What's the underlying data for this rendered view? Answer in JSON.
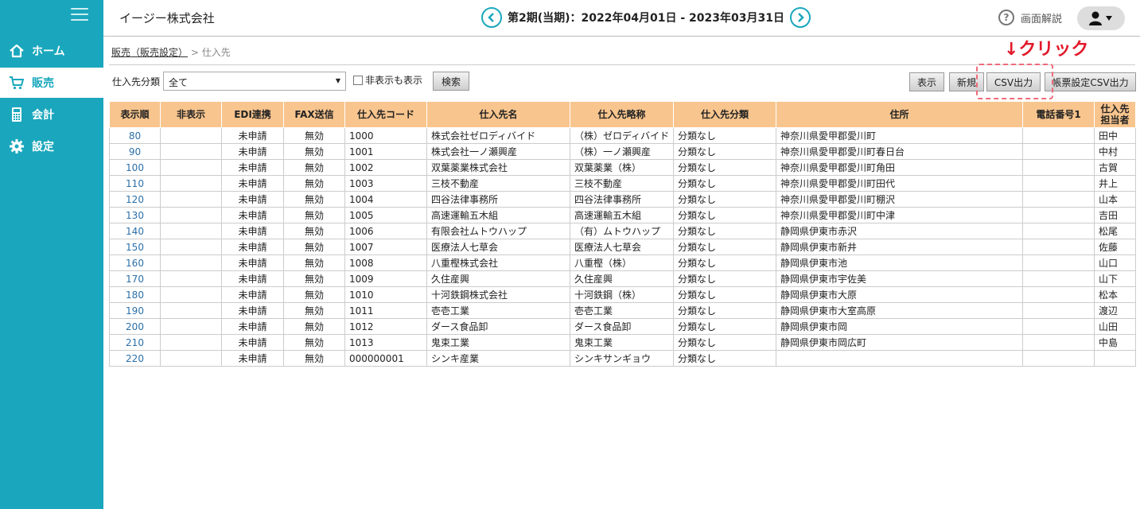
{
  "sidebar": {
    "items": [
      {
        "label": "ホーム",
        "icon": "home-icon"
      },
      {
        "label": "販売",
        "icon": "cart-icon"
      },
      {
        "label": "会計",
        "icon": "calculator-icon"
      },
      {
        "label": "設定",
        "icon": "gear-icon"
      }
    ],
    "active_index": 1
  },
  "header": {
    "company": "イージー株式会社",
    "period": "第2期(当期)：2022年04月01日 - 2023年03月31日",
    "help_label": "画面解説"
  },
  "breadcrumb": {
    "parent": "販売（販売設定）",
    "separator": ">",
    "current": "仕入先"
  },
  "toolbar": {
    "category_label": "仕入先分類",
    "category_value": "全て",
    "show_hidden_label": "非表示も表示",
    "search_label": "検索",
    "show_label": "表示",
    "new_label": "新規",
    "csv_label": "CSV出力",
    "form_csv_label": "帳票設定CSV出力"
  },
  "annotation": {
    "text": "↓クリック",
    "color": "#e2182a"
  },
  "colors": {
    "sidebar": "#1aa7bd",
    "table_header": "#f8c58e",
    "link": "#2b6fa8"
  },
  "table": {
    "headers": [
      "表示順",
      "非表示",
      "EDI連携",
      "FAX送信",
      "仕入先コード",
      "仕入先名",
      "仕入先略称",
      "仕入先分類",
      "住所",
      "電話番号1",
      "仕入先担当者"
    ],
    "rows": [
      [
        "80",
        "",
        "未申請",
        "無効",
        "1000",
        "株式会社ゼロディバイド",
        "（株）ゼロディバイド",
        "分類なし",
        "神奈川県愛甲郡愛川町",
        "",
        "田中"
      ],
      [
        "90",
        "",
        "未申請",
        "無効",
        "1001",
        "株式会社一ノ瀬興産",
        "（株）一ノ瀬興産",
        "分類なし",
        "神奈川県愛甲郡愛川町春日台",
        "",
        "中村"
      ],
      [
        "100",
        "",
        "未申請",
        "無効",
        "1002",
        "双葉薬業株式会社",
        "双葉薬業（株）",
        "分類なし",
        "神奈川県愛甲郡愛川町角田",
        "",
        "古賀"
      ],
      [
        "110",
        "",
        "未申請",
        "無効",
        "1003",
        "三枝不動産",
        "三枝不動産",
        "分類なし",
        "神奈川県愛甲郡愛川町田代",
        "",
        "井上"
      ],
      [
        "120",
        "",
        "未申請",
        "無効",
        "1004",
        "四谷法律事務所",
        "四谷法律事務所",
        "分類なし",
        "神奈川県愛甲郡愛川町棚沢",
        "",
        "山本"
      ],
      [
        "130",
        "",
        "未申請",
        "無効",
        "1005",
        "高速運輸五木組",
        "高速運輸五木組",
        "分類なし",
        "神奈川県愛甲郡愛川町中津",
        "",
        "吉田"
      ],
      [
        "140",
        "",
        "未申請",
        "無効",
        "1006",
        "有限会社ムトウハップ",
        "（有）ムトウハップ",
        "分類なし",
        "静岡県伊東市赤沢",
        "",
        "松尾"
      ],
      [
        "150",
        "",
        "未申請",
        "無効",
        "1007",
        "医療法人七草会",
        "医療法人七草会",
        "分類なし",
        "静岡県伊東市新井",
        "",
        "佐藤"
      ],
      [
        "160",
        "",
        "未申請",
        "無効",
        "1008",
        "八重樫株式会社",
        "八重樫（株）",
        "分類なし",
        "静岡県伊東市池",
        "",
        "山口"
      ],
      [
        "170",
        "",
        "未申請",
        "無効",
        "1009",
        "久住産興",
        "久住産興",
        "分類なし",
        "静岡県伊東市宇佐美",
        "",
        "山下"
      ],
      [
        "180",
        "",
        "未申請",
        "無効",
        "1010",
        "十河鉄鋼株式会社",
        "十河鉄鋼（株）",
        "分類なし",
        "静岡県伊東市大原",
        "",
        "松本"
      ],
      [
        "190",
        "",
        "未申請",
        "無効",
        "1011",
        "壱壱工業",
        "壱壱工業",
        "分類なし",
        "静岡県伊東市大室高原",
        "",
        "渡辺"
      ],
      [
        "200",
        "",
        "未申請",
        "無効",
        "1012",
        "ダース食品卸",
        "ダース食品卸",
        "分類なし",
        "静岡県伊東市岡",
        "",
        "山田"
      ],
      [
        "210",
        "",
        "未申請",
        "無効",
        "1013",
        "鬼束工業",
        "鬼束工業",
        "分類なし",
        "静岡県伊東市岡広町",
        "",
        "中島"
      ],
      [
        "220",
        "",
        "未申請",
        "無効",
        "000000001",
        "シンキ産業",
        "シンキサンギョウ",
        "分類なし",
        "",
        "",
        ""
      ]
    ]
  }
}
